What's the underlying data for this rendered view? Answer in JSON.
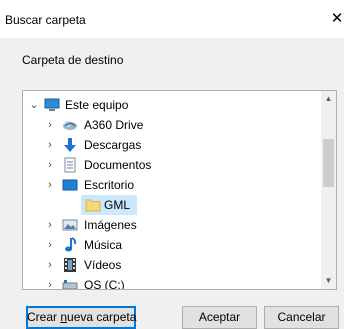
{
  "window": {
    "title": "Buscar carpeta",
    "close_glyph": "✕"
  },
  "dialog": {
    "destination_label": "Carpeta de destino"
  },
  "tree": {
    "items": [
      {
        "label": "Este equipo",
        "icon": "computer-icon",
        "expanded": true
      },
      {
        "label": "A360 Drive",
        "icon": "cloud-drive-icon"
      },
      {
        "label": "Descargas",
        "icon": "download-icon"
      },
      {
        "label": "Documentos",
        "icon": "document-icon"
      },
      {
        "label": "Escritorio",
        "icon": "desktop-icon",
        "expanded": true
      },
      {
        "label": "GML",
        "icon": "folder-icon",
        "selected": true
      },
      {
        "label": "Imágenes",
        "icon": "pictures-icon"
      },
      {
        "label": "Música",
        "icon": "music-icon"
      },
      {
        "label": "Vídeos",
        "icon": "videos-icon"
      },
      {
        "label": "OS (C:)",
        "icon": "drive-icon"
      }
    ]
  },
  "buttons": {
    "new_folder_pre": "Crear ",
    "new_folder_u": "n",
    "new_folder_post": "ueva carpeta",
    "ok": "Aceptar",
    "cancel": "Cancelar"
  },
  "colors": {
    "selection": "#cce8ff",
    "focus_border": "#0078d7",
    "dialog_bg": "#f0f0f0"
  }
}
